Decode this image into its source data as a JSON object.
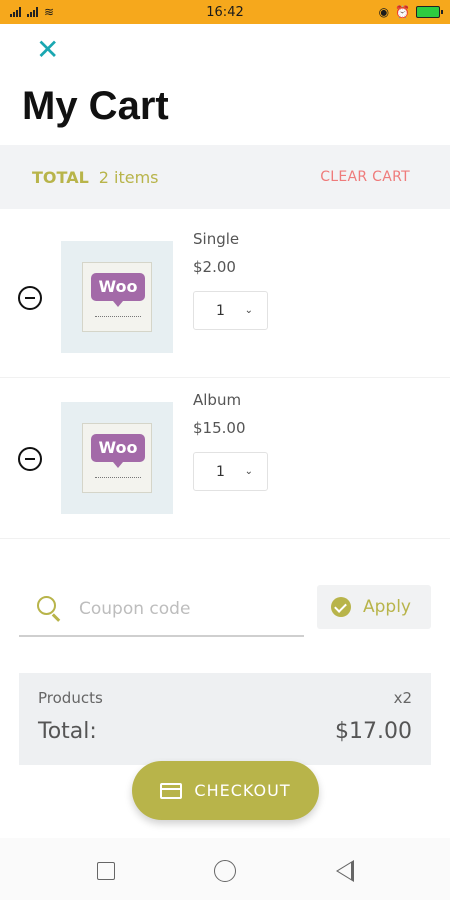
{
  "status_bar": {
    "time": "16:42",
    "carrier_text": "",
    "battery_color": "#2ecc40",
    "bar_color": "#f6a81c"
  },
  "header": {
    "close_icon": "close-icon",
    "title": "My Cart"
  },
  "total_bar": {
    "label": "TOTAL",
    "items_count": "2 items",
    "clear_label": "CLEAR CART"
  },
  "cart": {
    "items": [
      {
        "name": "Single",
        "price": "$2.00",
        "quantity": "1"
      },
      {
        "name": "Album",
        "price": "$15.00",
        "quantity": "1"
      }
    ],
    "thumb_logo_text": "Woo"
  },
  "coupon": {
    "placeholder": "Coupon code",
    "apply_label": "Apply"
  },
  "summary": {
    "products_label": "Products",
    "products_count": "x2",
    "total_label": "Total:",
    "total_value": "$17.00"
  },
  "checkout": {
    "label": "CHECKOUT"
  },
  "colors": {
    "accent": "#b8b44a",
    "danger": "#ef7b7b",
    "close_icon": "#1aa7b1",
    "woo_purple": "#a36aa8"
  }
}
